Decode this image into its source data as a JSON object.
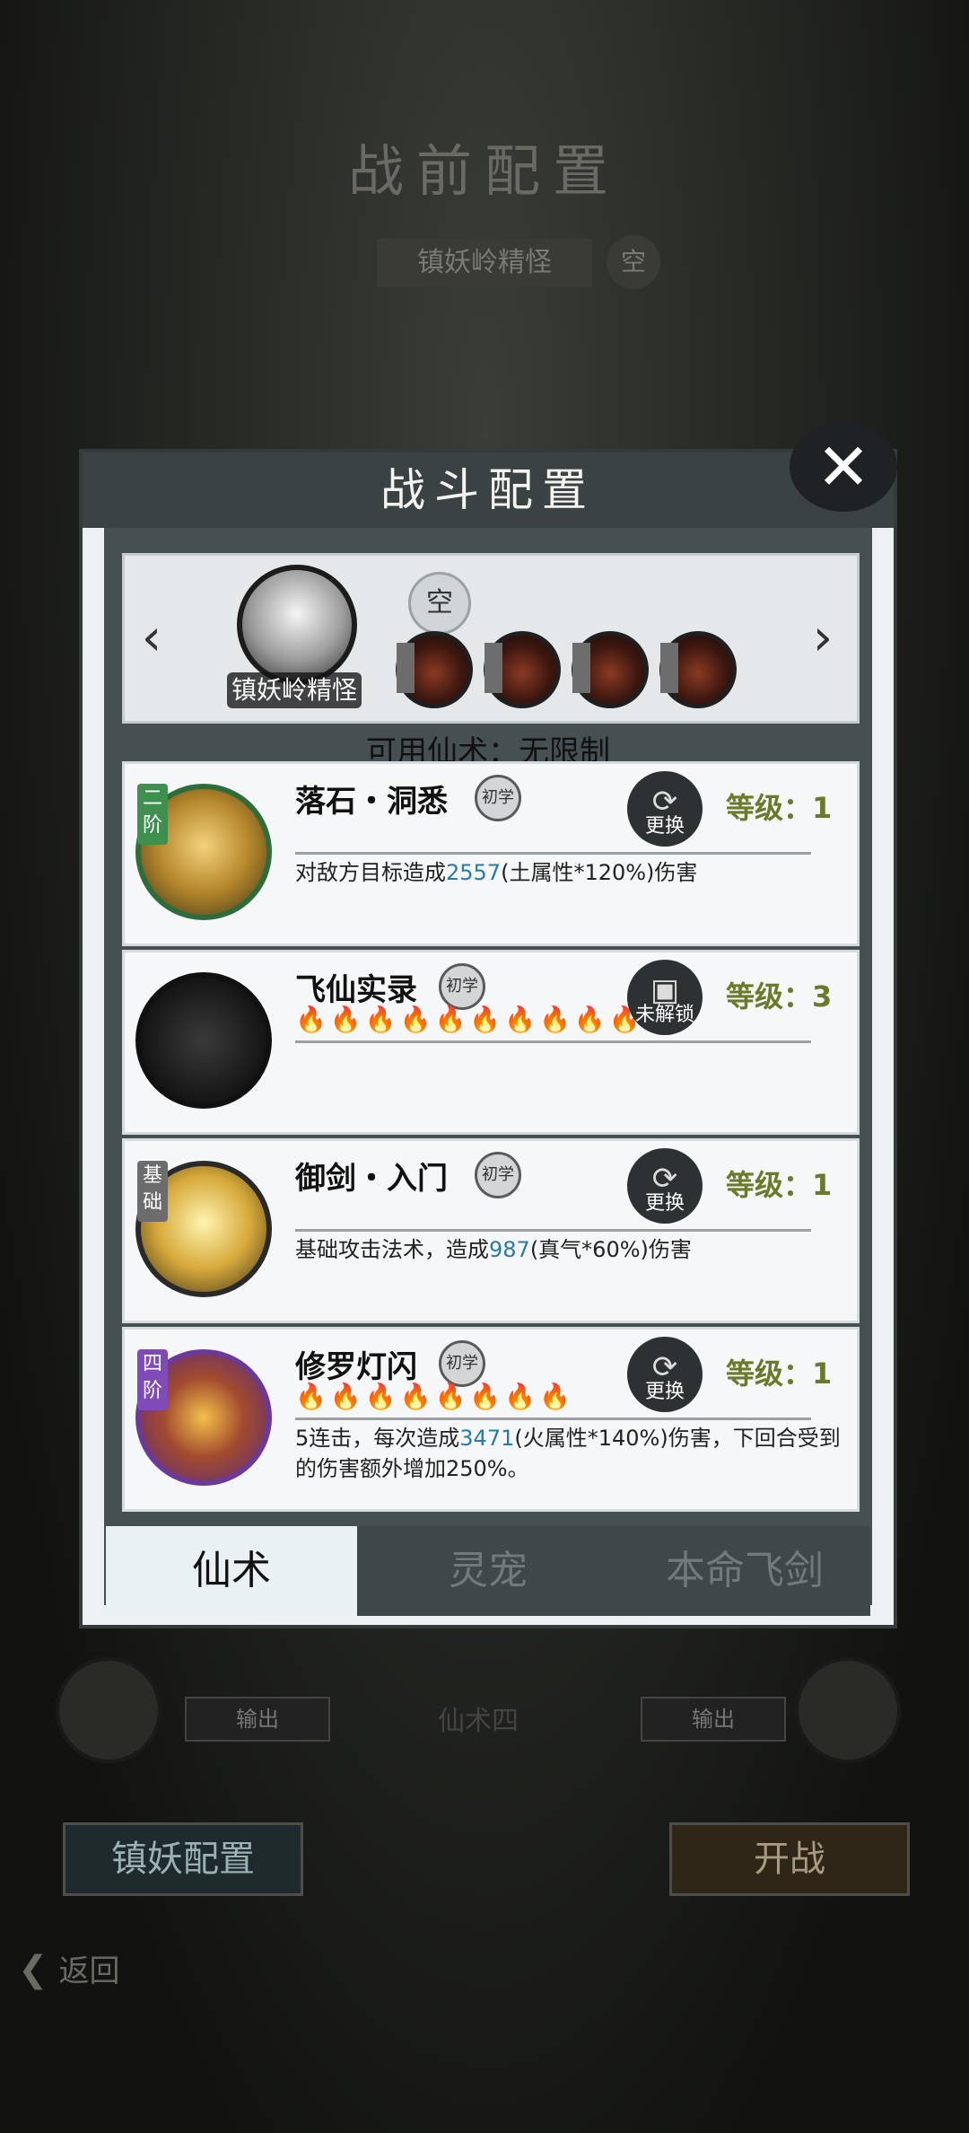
{
  "background": {
    "title": "战前配置",
    "stage": "镇妖岭精怪",
    "stage_empty": "空",
    "output_label": "输出",
    "middle_slot": "仙术四",
    "left_button": "镇妖配置",
    "right_button": "开战",
    "back_label": "返回"
  },
  "dialog": {
    "title": "战斗配置",
    "close_icon": "close-icon",
    "pet": {
      "name": "镇妖岭精怪",
      "empty_slot": "空"
    },
    "available": "可用仙术：无限制",
    "skills": [
      {
        "tier": "二阶",
        "tier_color": "#3f8f4f",
        "name": "落石・洞悉",
        "grade": "初学",
        "action": "更换",
        "level": "等级：1",
        "desc_prefix": "对敌方目标造成",
        "desc_value": "2557",
        "desc_suffix": "(土属性*120%)伤害",
        "icon_color": "#c8a24a"
      },
      {
        "tier": "",
        "name": "飞仙实录",
        "grade": "初学",
        "action": "未解锁",
        "level": "等级：3",
        "flames": "🔥🔥🔥🔥🔥🔥🔥🔥🔥🔥",
        "icon_color": "#111111"
      },
      {
        "tier": "基础",
        "tier_color": "#6c6c6c",
        "name": "御剑・入门",
        "grade": "初学",
        "action": "更换",
        "level": "等级：1",
        "desc_prefix": "基础攻击法术，造成",
        "desc_value": "987",
        "desc_suffix": "(真气*60%)伤害",
        "icon_color": "#d8b24c"
      },
      {
        "tier": "四阶",
        "tier_color": "#7e4bb8",
        "name": "修罗灯闪",
        "grade": "初学",
        "action": "更换",
        "level": "等级：1",
        "flames": "🔥🔥🔥🔥🔥🔥🔥🔥",
        "desc_prefix": "5连击，每次造成",
        "desc_value": "3471",
        "desc_suffix": "(火属性*140%)伤害，下回合受到的伤害额外增加250%。",
        "icon_color": "#8a3fb8"
      }
    ],
    "tabs": [
      "仙术",
      "灵宠",
      "本命飞剑"
    ]
  }
}
